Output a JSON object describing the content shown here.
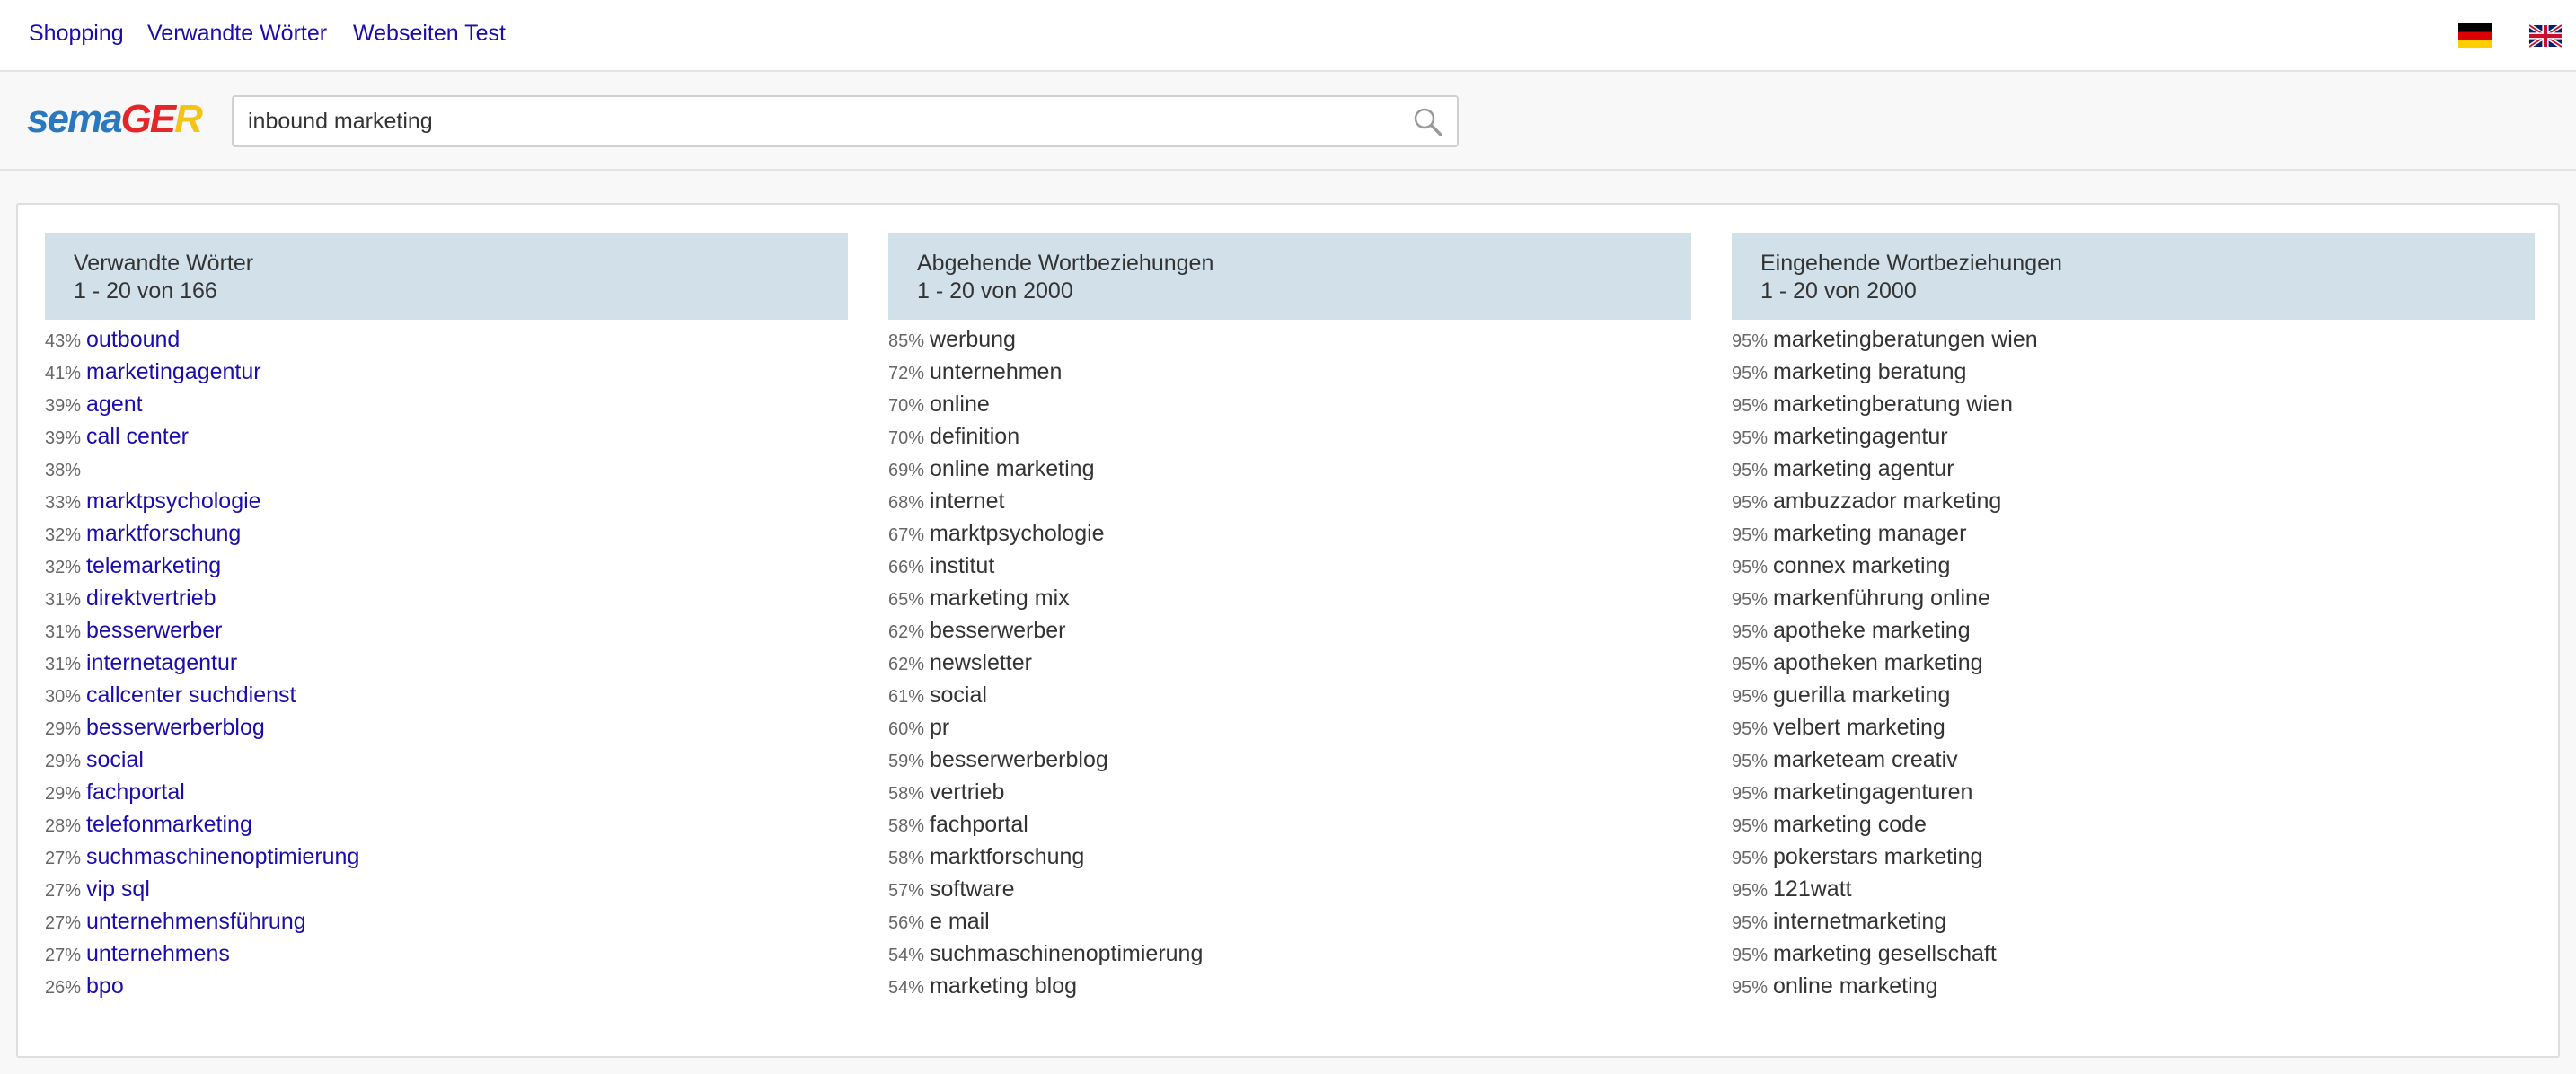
{
  "nav": {
    "links": [
      "Shopping",
      "Verwandte Wörter",
      "Webseiten Test"
    ]
  },
  "search": {
    "value": "inbound marketing"
  },
  "logo": {
    "part1": "sema",
    "part2": "GE",
    "part3": "R"
  },
  "colors": {
    "link": "#1a0dab",
    "header_bg": "#d2e0ea",
    "logo_blue": "#2a79c0",
    "logo_red": "#e3262a",
    "logo_yellow": "#f3c417"
  },
  "columns": [
    {
      "title": "Verwandte Wörter",
      "range": "1 - 20 von 166",
      "linked": true,
      "items": [
        {
          "pct": "43%",
          "word": "outbound"
        },
        {
          "pct": "41%",
          "word": "marketingagentur"
        },
        {
          "pct": "39%",
          "word": "agent"
        },
        {
          "pct": "39%",
          "word": "call center"
        },
        {
          "pct": "38%",
          "word": ""
        },
        {
          "pct": "33%",
          "word": "marktpsychologie"
        },
        {
          "pct": "32%",
          "word": "marktforschung"
        },
        {
          "pct": "32%",
          "word": "telemarketing"
        },
        {
          "pct": "31%",
          "word": "direktvertrieb"
        },
        {
          "pct": "31%",
          "word": "besserwerber"
        },
        {
          "pct": "31%",
          "word": "internetagentur"
        },
        {
          "pct": "30%",
          "word": "callcenter suchdienst"
        },
        {
          "pct": "29%",
          "word": "besserwerberblog"
        },
        {
          "pct": "29%",
          "word": "social"
        },
        {
          "pct": "29%",
          "word": "fachportal"
        },
        {
          "pct": "28%",
          "word": "telefonmarketing"
        },
        {
          "pct": "27%",
          "word": "suchmaschinenoptimierung"
        },
        {
          "pct": "27%",
          "word": "vip sql"
        },
        {
          "pct": "27%",
          "word": "unternehmensführung"
        },
        {
          "pct": "27%",
          "word": "unternehmens"
        },
        {
          "pct": "26%",
          "word": "bpo"
        }
      ]
    },
    {
      "title": "Abgehende Wortbeziehungen",
      "range": "1 - 20 von 2000",
      "linked": false,
      "items": [
        {
          "pct": "85%",
          "word": "werbung"
        },
        {
          "pct": "72%",
          "word": "unternehmen"
        },
        {
          "pct": "70%",
          "word": "online"
        },
        {
          "pct": "70%",
          "word": "definition"
        },
        {
          "pct": "69%",
          "word": "online marketing"
        },
        {
          "pct": "68%",
          "word": "internet"
        },
        {
          "pct": "67%",
          "word": "marktpsychologie"
        },
        {
          "pct": "66%",
          "word": "institut"
        },
        {
          "pct": "65%",
          "word": "marketing mix"
        },
        {
          "pct": "62%",
          "word": "besserwerber"
        },
        {
          "pct": "62%",
          "word": "newsletter"
        },
        {
          "pct": "61%",
          "word": "social"
        },
        {
          "pct": "60%",
          "word": "pr"
        },
        {
          "pct": "59%",
          "word": "besserwerberblog"
        },
        {
          "pct": "58%",
          "word": "vertrieb"
        },
        {
          "pct": "58%",
          "word": "fachportal"
        },
        {
          "pct": "58%",
          "word": "marktforschung"
        },
        {
          "pct": "57%",
          "word": "software"
        },
        {
          "pct": "56%",
          "word": "e mail"
        },
        {
          "pct": "54%",
          "word": "suchmaschinenoptimierung"
        },
        {
          "pct": "54%",
          "word": "marketing blog"
        }
      ]
    },
    {
      "title": "Eingehende Wortbeziehungen",
      "range": "1 - 20 von 2000",
      "linked": false,
      "items": [
        {
          "pct": "95%",
          "word": "marketingberatungen wien"
        },
        {
          "pct": "95%",
          "word": "marketing beratung"
        },
        {
          "pct": "95%",
          "word": "marketingberatung wien"
        },
        {
          "pct": "95%",
          "word": "marketingagentur"
        },
        {
          "pct": "95%",
          "word": "marketing agentur"
        },
        {
          "pct": "95%",
          "word": "ambuzzador marketing"
        },
        {
          "pct": "95%",
          "word": "marketing manager"
        },
        {
          "pct": "95%",
          "word": "connex marketing"
        },
        {
          "pct": "95%",
          "word": "markenführung online"
        },
        {
          "pct": "95%",
          "word": "apotheke marketing"
        },
        {
          "pct": "95%",
          "word": "apotheken marketing"
        },
        {
          "pct": "95%",
          "word": "guerilla marketing"
        },
        {
          "pct": "95%",
          "word": "velbert marketing"
        },
        {
          "pct": "95%",
          "word": "marketeam creativ"
        },
        {
          "pct": "95%",
          "word": "marketingagenturen"
        },
        {
          "pct": "95%",
          "word": "marketing code"
        },
        {
          "pct": "95%",
          "word": "pokerstars marketing"
        },
        {
          "pct": "95%",
          "word": "121watt"
        },
        {
          "pct": "95%",
          "word": "internetmarketing"
        },
        {
          "pct": "95%",
          "word": "marketing gesellschaft"
        },
        {
          "pct": "95%",
          "word": "online marketing"
        }
      ]
    }
  ]
}
